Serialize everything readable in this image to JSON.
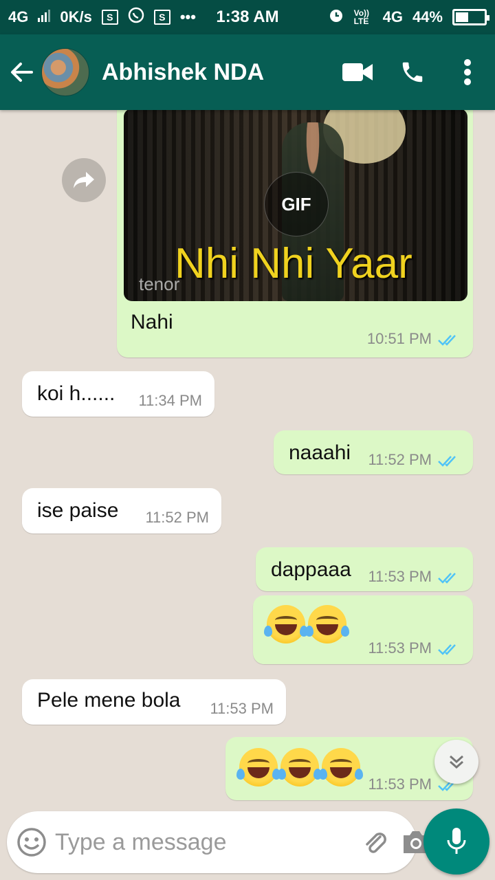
{
  "status_bar": {
    "network_left": "4G",
    "speed": "0K/s",
    "sim_badge": "S",
    "more": "•••",
    "time": "1:38 AM",
    "volte": "Vo)) LTE",
    "network_right": "4G",
    "battery": "44%"
  },
  "header": {
    "contact_name": "Abhishek NDA",
    "icons": [
      "back-arrow-icon",
      "video-call-icon",
      "phone-icon",
      "more-vert-icon"
    ],
    "color": "#075e54"
  },
  "messages": [
    {
      "dir": "out",
      "type": "gif",
      "gif_badge": "GIF",
      "gif_caption": "Nhi Nhi Yaar",
      "gif_source": "tenor",
      "text": "Nahi",
      "time": "10:51 PM",
      "ticks": "read"
    },
    {
      "dir": "in",
      "text": "koi h......",
      "time": "11:34 PM"
    },
    {
      "dir": "out",
      "text": "naaahi",
      "time": "11:52 PM",
      "ticks": "read"
    },
    {
      "dir": "in",
      "text": "ise paise",
      "time": "11:52 PM"
    },
    {
      "dir": "out",
      "text": "dappaaa",
      "time": "11:53 PM",
      "ticks": "read"
    },
    {
      "dir": "out",
      "emoji": [
        "face-with-tears-of-joy",
        "face-with-tears-of-joy"
      ],
      "time": "11:53 PM",
      "ticks": "read"
    },
    {
      "dir": "in",
      "text": "Pele mene bola",
      "time": "11:53 PM"
    },
    {
      "dir": "out",
      "emoji": [
        "face-with-tears-of-joy",
        "face-with-tears-of-joy",
        "face-with-tears-of-joy"
      ],
      "time": "11:53 PM",
      "ticks": "read"
    }
  ],
  "composer": {
    "placeholder": "Type a message",
    "icons": [
      "emoji-icon",
      "attach-icon",
      "camera-icon",
      "mic-icon"
    ]
  },
  "colors": {
    "outgoing_bubble": "#dcf8c6",
    "incoming_bubble": "#ffffff",
    "read_tick": "#4fc3f7",
    "accent": "#00897b"
  }
}
